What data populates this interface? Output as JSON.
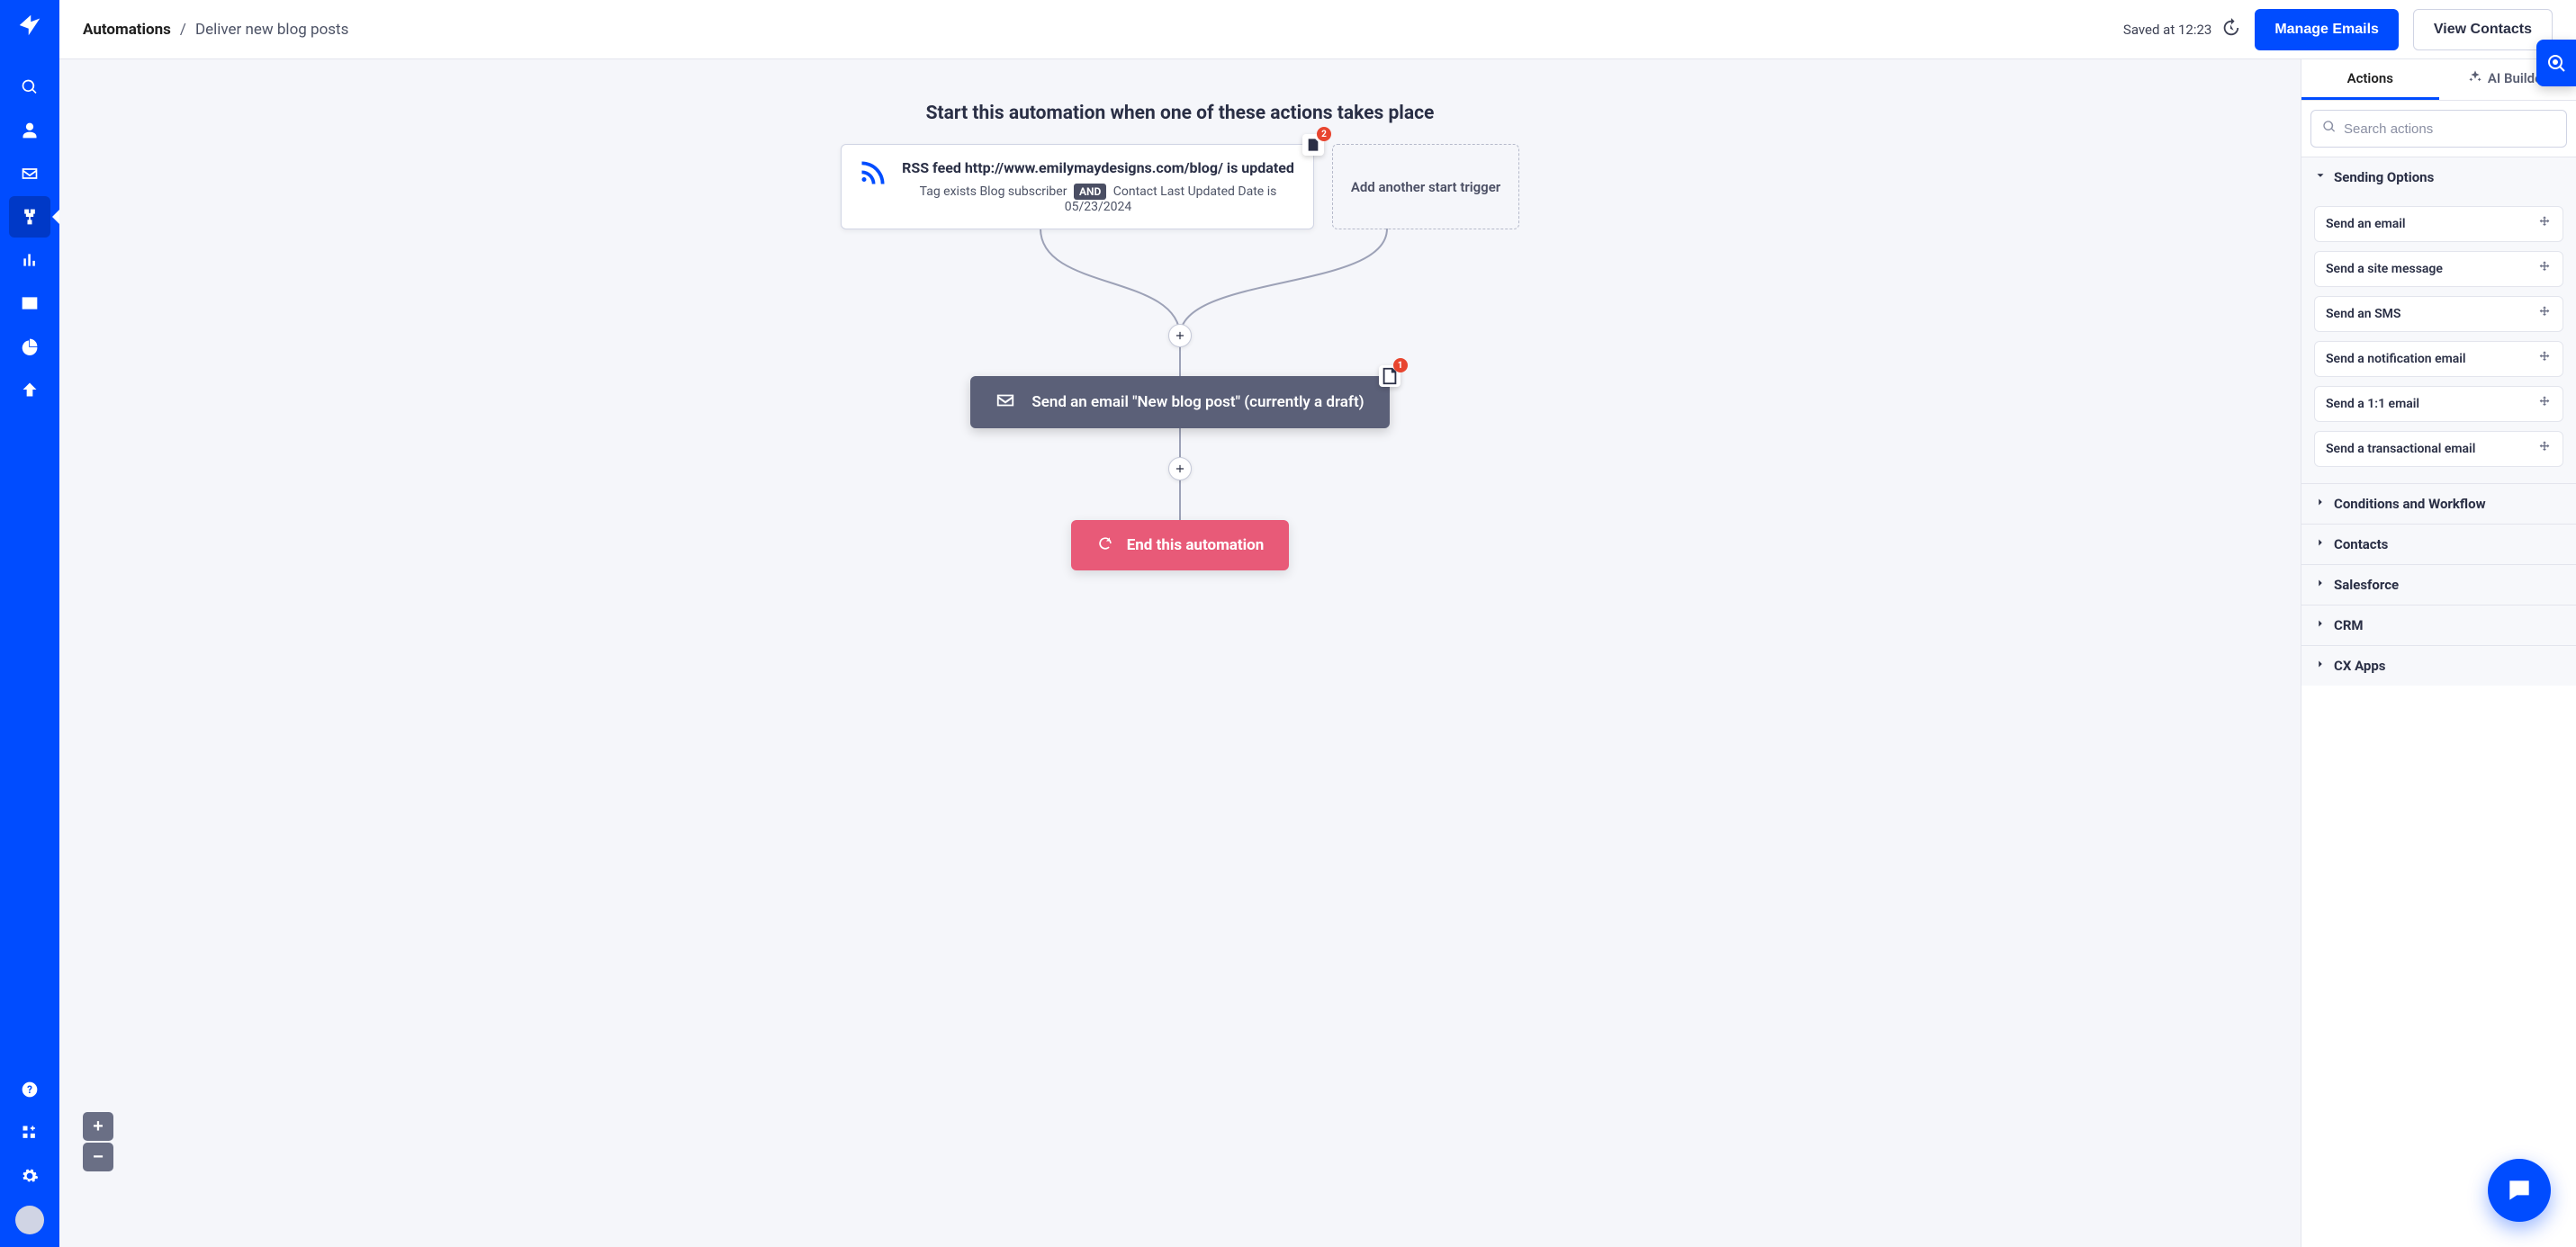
{
  "header": {
    "breadcrumb_root": "Automations",
    "breadcrumb_sep": "/",
    "title": "Deliver new blog posts",
    "saved_text": "Saved at 12:23",
    "manage_emails": "Manage Emails",
    "view_contacts": "View Contacts"
  },
  "canvas": {
    "start_heading": "Start this automation when one of these actions takes place",
    "trigger": {
      "title": "RSS feed http://www.emilymaydesigns.com/blog/ is updated",
      "sub_pre": "Tag exists Blog subscriber",
      "and": "AND",
      "sub_post": "Contact Last Updated Date is 05/23/2024",
      "note_count": "2"
    },
    "add_trigger": "Add another start trigger",
    "email_node": "Send an email \"New blog post\" (currently a draft)",
    "email_note_count": "1",
    "end_node": "End this automation"
  },
  "panel": {
    "tabs": {
      "actions": "Actions",
      "ai": "AI Builder"
    },
    "search_placeholder": "Search actions",
    "sections": {
      "sending": "Sending Options",
      "sending_items": [
        "Send an email",
        "Send a site message",
        "Send an SMS",
        "Send a notification email",
        "Send a 1:1 email",
        "Send a transactional email"
      ],
      "conditions": "Conditions and Workflow",
      "contacts": "Contacts",
      "salesforce": "Salesforce",
      "crm": "CRM",
      "cx": "CX Apps"
    }
  }
}
